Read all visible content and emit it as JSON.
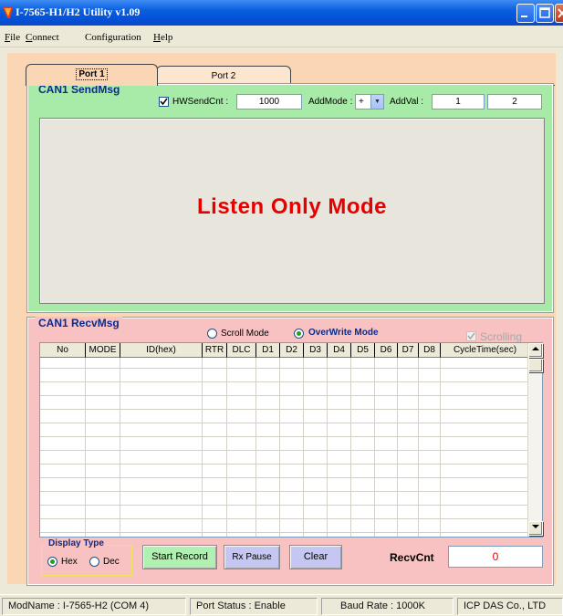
{
  "window": {
    "title": "I-7565-H1/H2 Utility v1.09",
    "icon": "app-icon",
    "controls": [
      "minimize-icon",
      "maximize-icon",
      "close-icon"
    ]
  },
  "menu": {
    "items": [
      {
        "label": "File",
        "key": "F",
        "rest": "ile"
      },
      {
        "label": "Connect",
        "key": "C",
        "rest": "onnect"
      },
      {
        "label": "Configuration",
        "key": "",
        "rest": "Configuration"
      },
      {
        "label": "Help",
        "key": "H",
        "rest": "elp"
      }
    ]
  },
  "tabs": [
    {
      "label": "Port 1",
      "active": true
    },
    {
      "label": "Port 2",
      "active": false
    }
  ],
  "send": {
    "title": "CAN1 SendMsg",
    "hw_send_cnt_label": "HWSendCnt :",
    "hw_send_cnt_checked": true,
    "hw_send_cnt_value": "1000",
    "add_mode_label": "AddMode :",
    "add_mode_value": "+",
    "add_val_label": "AddVal :",
    "add_val_1": "1",
    "add_val_2": "2",
    "mode_message": "Listen Only Mode"
  },
  "recv": {
    "title": "CAN1 RecvMsg",
    "scroll_mode_label": "Scroll Mode",
    "overwrite_mode_label": "OverWrite Mode",
    "selected_mode": "OverWrite Mode",
    "scrolling_label": "Scrolling",
    "scrolling_checked": true,
    "columns": [
      "No",
      "MODE",
      "ID(hex)",
      "RTR",
      "DLC",
      "D1",
      "D2",
      "D3",
      "D4",
      "D5",
      "D6",
      "D7",
      "D8",
      "CycleTime(sec)"
    ],
    "display_type_title": "Display Type",
    "hex_label": "Hex",
    "dec_label": "Dec",
    "display_type_selected": "Hex",
    "start_record_label": "Start Record",
    "rx_pause_label": "Rx Pause",
    "clear_label": "Clear",
    "recv_cnt_label": "RecvCnt",
    "recv_cnt_value": "0"
  },
  "status": {
    "mod_name": "ModName : I-7565-H2 (COM 4)",
    "port_status": "Port Status : Enable",
    "baud_rate": "Baud Rate : 1000K",
    "company": "ICP DAS Co., LTD"
  },
  "colors": {
    "send_group": "#a8eaa8",
    "recv_group": "#f8c2c2",
    "panel": "#fbd6b4",
    "mode_message": "#e60000",
    "group_title": "#0b2a8a"
  }
}
